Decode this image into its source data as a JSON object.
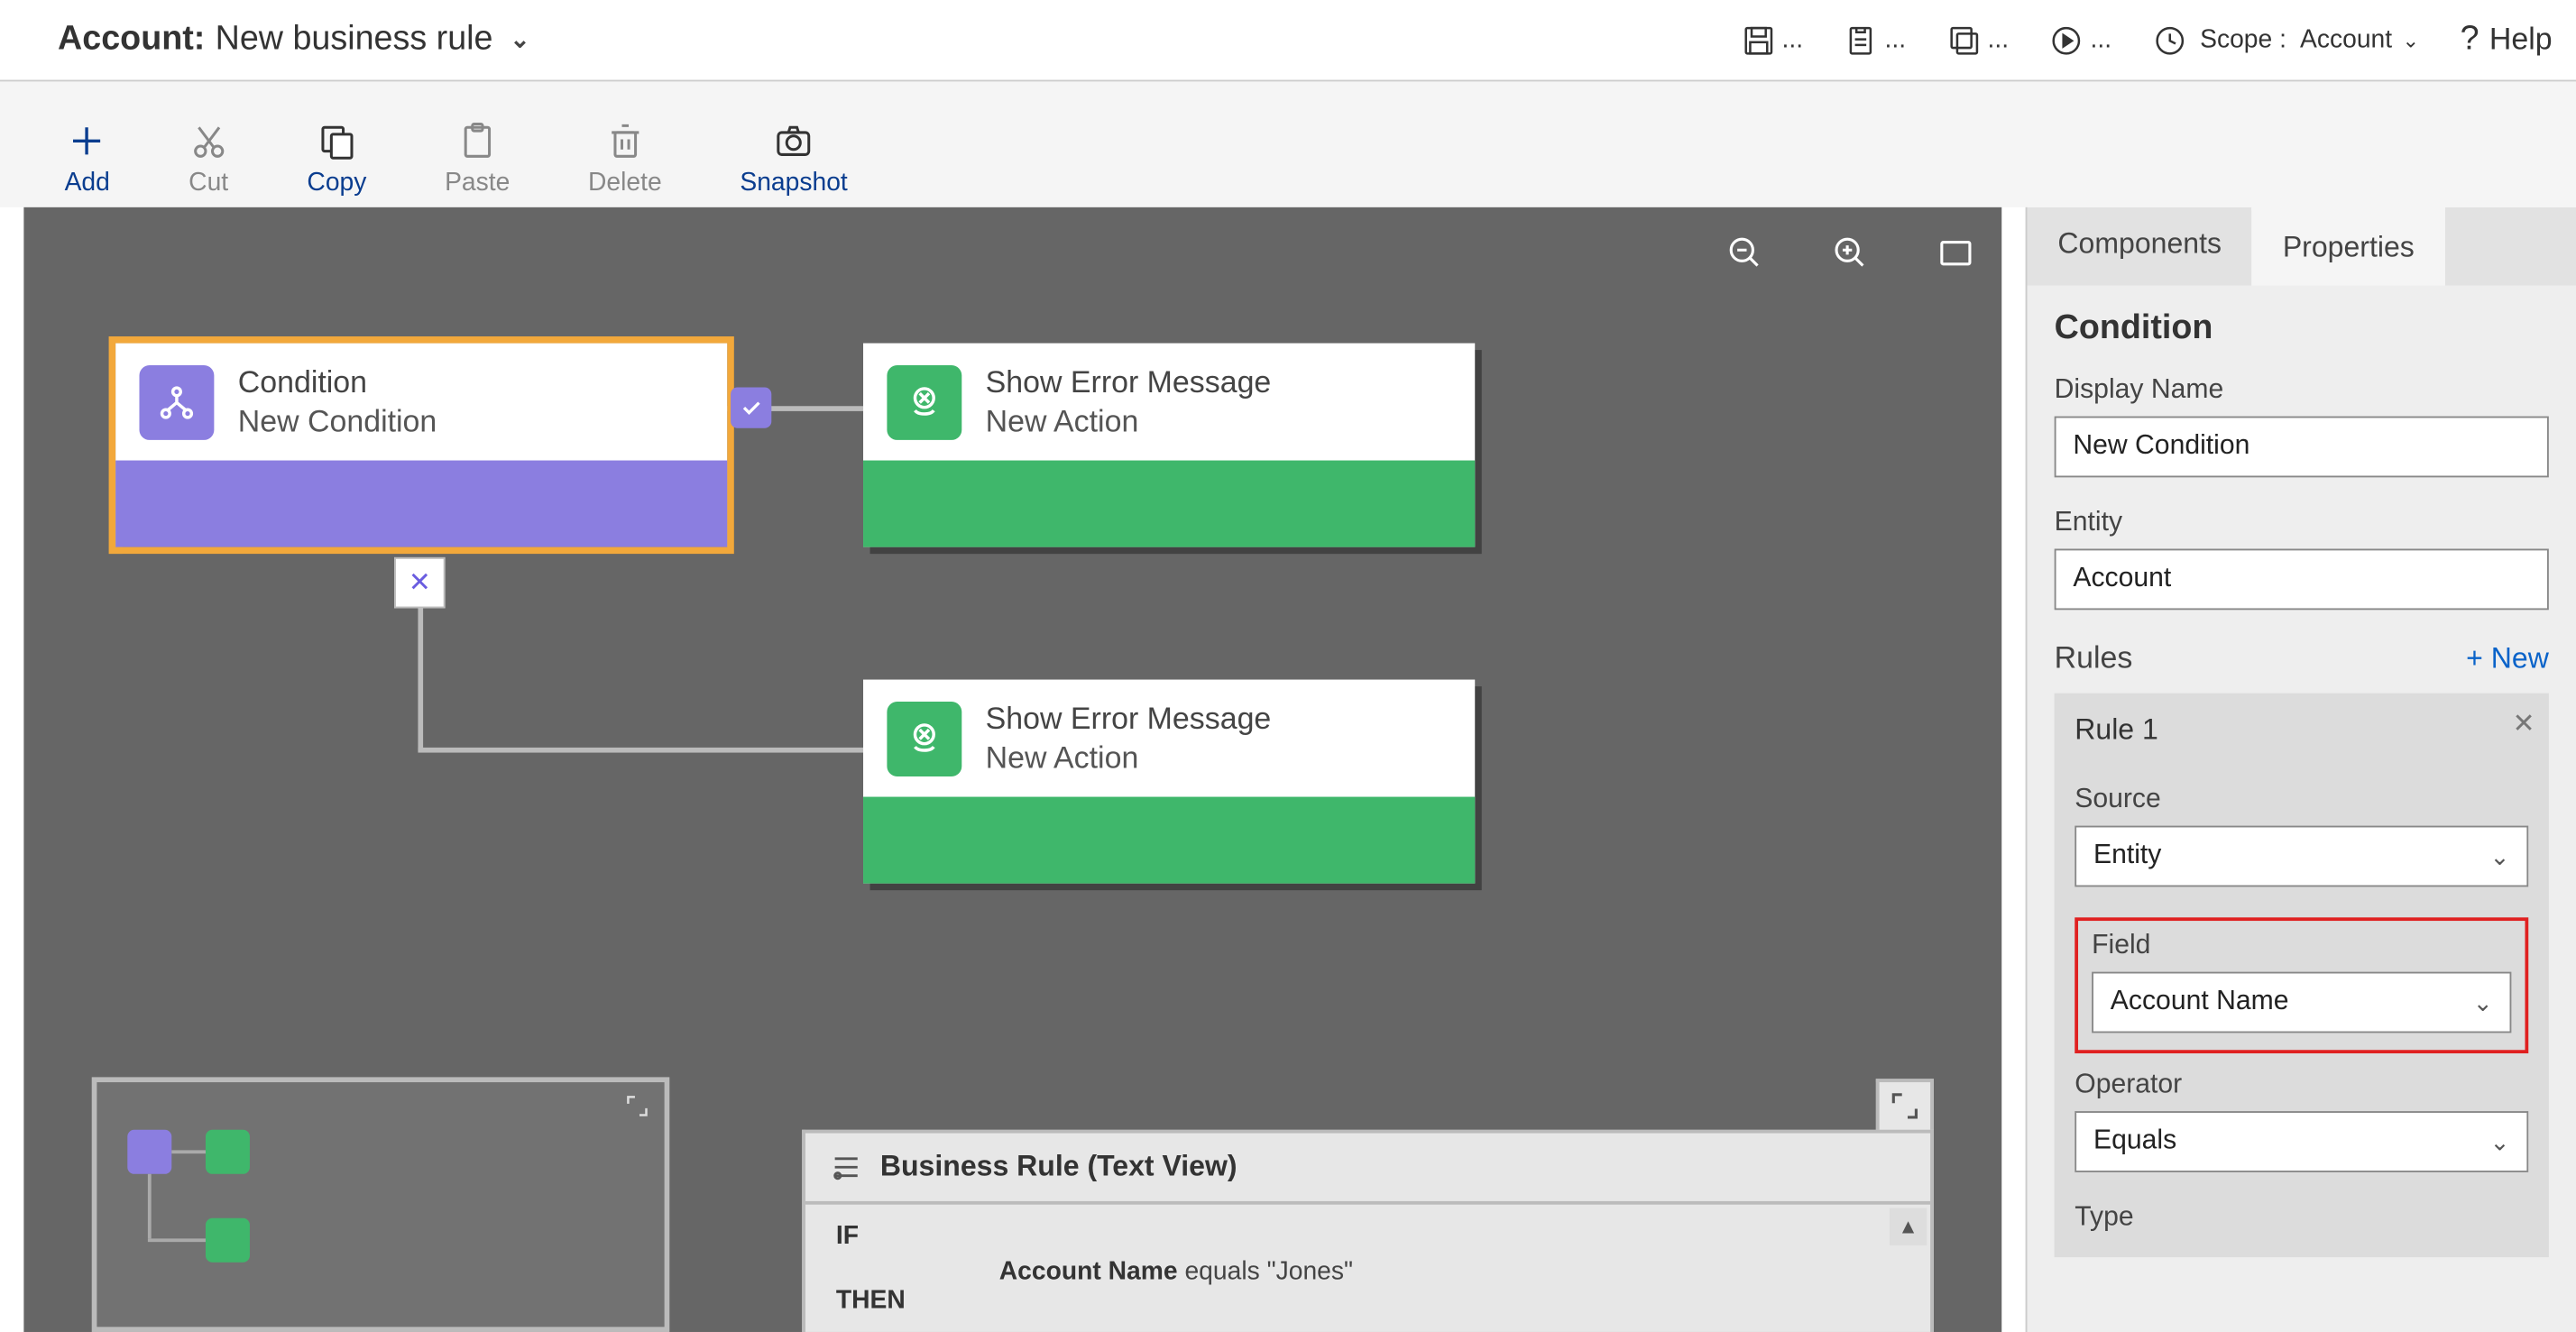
{
  "titlebar": {
    "prefix": "Account:",
    "ruleName": "New business rule",
    "scopeLabel": "Scope :",
    "scopeValue": "Account",
    "help": "Help"
  },
  "toolbar": {
    "add": "Add",
    "cut": "Cut",
    "copy": "Copy",
    "paste": "Paste",
    "delete": "Delete",
    "snapshot": "Snapshot"
  },
  "nodes": {
    "condition": {
      "title": "Condition",
      "subtitle": "New Condition"
    },
    "action1": {
      "title": "Show Error Message",
      "subtitle": "New Action"
    },
    "action2": {
      "title": "Show Error Message",
      "subtitle": "New Action"
    }
  },
  "textView": {
    "header": "Business Rule (Text View)",
    "ifLabel": "IF",
    "thenLabel": "THEN",
    "line1_field": "Account Name",
    "line1_rest": " equals \"Jones\""
  },
  "props": {
    "tabs": {
      "components": "Components",
      "properties": "Properties"
    },
    "sectionTitle": "Condition",
    "displayNameLabel": "Display Name",
    "displayNameValue": "New Condition",
    "entityLabel": "Entity",
    "entityValue": "Account",
    "rulesTitle": "Rules",
    "newLabel": "+  New",
    "ruleCardTitle": "Rule 1",
    "sourceLabel": "Source",
    "sourceValue": "Entity",
    "fieldLabel": "Field",
    "fieldValue": "Account Name",
    "operatorLabel": "Operator",
    "operatorValue": "Equals",
    "typeLabel": "Type"
  }
}
